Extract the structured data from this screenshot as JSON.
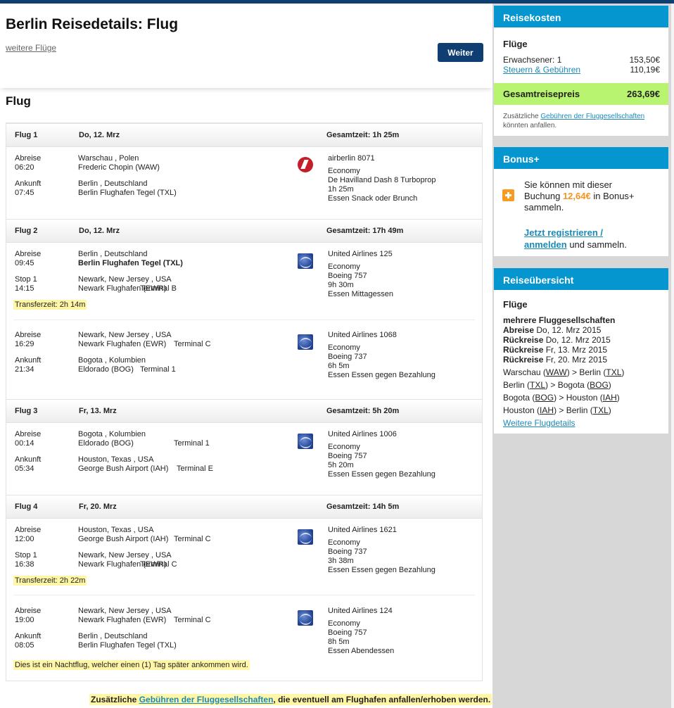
{
  "header": {
    "title": "Berlin Reisedetails: Flug",
    "more_flights": "weitere Flüge",
    "continue_label": "Weiter"
  },
  "section_title": "Flug",
  "labels": {
    "departure": "Abreise",
    "arrival": "Ankunft",
    "stop": "Stop 1"
  },
  "flights": [
    {
      "title": "Flug 1",
      "date": "Do, 12. Mrz",
      "total_time": "Gesamtzeit: 1h 25m",
      "segments": [
        {
          "dep_time": "06:20",
          "dep_place": "Warschau , Polen",
          "dep_airport": "Frederic Chopin (WAW)",
          "dep_terminal": "",
          "arr_time": "07:45",
          "arr_place": "Berlin , Deutschland",
          "arr_airport": "Berlin Flughafen Tegel (TXL)",
          "arr_terminal": "",
          "airline_logo": "airberlin-logo",
          "flight_no": "airberlin 8071",
          "cabin": "Economy",
          "aircraft": "De Havilland Dash 8 Turboprop",
          "duration": "1h 25m",
          "meal": "Essen Snack oder Brunch"
        }
      ]
    },
    {
      "title": "Flug 2",
      "date": "Do, 12. Mrz",
      "total_time": "Gesamtzeit: 17h 49m",
      "segments": [
        {
          "dep_time": "09:45",
          "dep_place": "Berlin , Deutschland",
          "dep_airport": "Berlin Flughafen Tegel (TXL)",
          "dep_terminal": "",
          "arr_time": "14:15",
          "arr_place": "Newark, New Jersey , USA",
          "arr_airport": "Newark Flughafen (EWR)",
          "arr_terminal": "Terminal B",
          "airline_logo": "united-airlines-logo",
          "flight_no": "United Airlines 125",
          "cabin": "Economy",
          "aircraft": "Boeing 757",
          "duration": "9h 30m",
          "meal": "Essen Mittagessen",
          "transfer": "Transferzeit: 2h 14m"
        },
        {
          "dep_time": "16:29",
          "dep_place": "Newark, New Jersey , USA",
          "dep_airport": "Newark Flughafen (EWR)",
          "dep_terminal": "Terminal C",
          "arr_time": "21:34",
          "arr_place": "Bogota , Kolumbien",
          "arr_airport": "Eldorado (BOG)",
          "arr_terminal": "Terminal 1",
          "airline_logo": "united-airlines-logo",
          "flight_no": "United Airlines 1068",
          "cabin": "Economy",
          "aircraft": "Boeing 737",
          "duration": "6h 5m",
          "meal": "Essen Essen gegen Bezahlung"
        }
      ]
    },
    {
      "title": "Flug 3",
      "date": "Fr, 13. Mrz",
      "total_time": "Gesamtzeit: 5h 20m",
      "segments": [
        {
          "dep_time": "00:14",
          "dep_place": "Bogota , Kolumbien",
          "dep_airport": "Eldorado (BOG)",
          "dep_terminal": "Terminal 1",
          "arr_time": "05:34",
          "arr_place": "Houston, Texas , USA",
          "arr_airport": "George Bush Airport (IAH)",
          "arr_terminal": "Terminal E",
          "airline_logo": "united-airlines-logo",
          "flight_no": "United Airlines 1006",
          "cabin": "Economy",
          "aircraft": "Boeing 757",
          "duration": "5h 20m",
          "meal": "Essen Essen gegen Bezahlung"
        }
      ]
    },
    {
      "title": "Flug 4",
      "date": "Fr, 20. Mrz",
      "total_time": "Gesamtzeit: 14h 5m",
      "segments": [
        {
          "dep_time": "12:00",
          "dep_place": "Houston, Texas , USA",
          "dep_airport": "George Bush Airport (IAH)",
          "dep_terminal": "Terminal C",
          "arr_time": "16:38",
          "arr_place": "Newark, New Jersey , USA",
          "arr_airport": "Newark Flughafen (EWR)",
          "arr_terminal": "Terminal C",
          "airline_logo": "united-airlines-logo",
          "flight_no": "United Airlines 1621",
          "cabin": "Economy",
          "aircraft": "Boeing 737",
          "duration": "3h 38m",
          "meal": "Essen Essen gegen Bezahlung",
          "transfer": "Transferzeit: 2h 22m"
        },
        {
          "dep_time": "19:00",
          "dep_place": "Newark, New Jersey , USA",
          "dep_airport": "Newark Flughafen (EWR)",
          "dep_terminal": "Terminal C",
          "arr_time": "08:05",
          "arr_place": "Berlin , Deutschland",
          "arr_airport": "Berlin Flughafen Tegel (TXL)",
          "arr_terminal": "",
          "airline_logo": "united-airlines-logo",
          "flight_no": "United Airlines 124",
          "cabin": "Economy",
          "aircraft": "Boeing 757",
          "duration": "8h 5m",
          "meal": "Essen Abendessen"
        }
      ],
      "night_note": "Dies ist ein Nachtflug, welcher einen (1) Tag später ankommen wird."
    }
  ],
  "footer_note": {
    "prefix": "Zusätzliche",
    "link": "Gebühren der Fluggesellschaften",
    "suffix": ", die eventuell am Flughafen anfallen/erhoben werden."
  },
  "costs": {
    "title": "Reisekosten",
    "subtitle": "Flüge",
    "adult_label": "Erwachsener: 1",
    "adult_price": "153,50€",
    "tax_label": "Steuern & Gebühren",
    "tax_price": "110,19€",
    "total_label": "Gesamtreisepreis",
    "total_price": "263,69€",
    "note_prefix": "Zusätzliche",
    "note_link": "Gebühren der Fluggesellschaften",
    "note_suffix": "könnten anfallen."
  },
  "bonus": {
    "title": "Bonus+",
    "line1": "Sie können mit dieser",
    "line2_prefix": "Buchung",
    "amount": "12,64€",
    "line2_suffix": "in Bonus+",
    "line3": "sammeln.",
    "register_line1": "Jetzt registrieren /",
    "register_line2": "anmelden",
    "register_suffix": "und sammeln."
  },
  "overview": {
    "title": "Reiseübersicht",
    "subtitle": "Flüge",
    "airlines": "mehrere Fluggesellschaften",
    "legs": [
      {
        "label": "Abreise",
        "date": "Do, 12. Mrz 2015"
      },
      {
        "label": "Rückreise",
        "date": "Do, 12. Mrz 2015"
      },
      {
        "label": "Rückreise",
        "date": "Fr, 13. Mrz 2015"
      },
      {
        "label": "Rückreise",
        "date": "Fr, 20. Mrz 2015"
      }
    ],
    "routes": [
      {
        "from": "Warschau",
        "from_code": "WAW",
        "to": "Berlin",
        "to_code": "TXL"
      },
      {
        "from": "Berlin",
        "from_code": "TXL",
        "to": "Bogota",
        "to_code": "BOG"
      },
      {
        "from": "Bogota",
        "from_code": "BOG",
        "to": "Houston",
        "to_code": "IAH"
      },
      {
        "from": "Houston",
        "from_code": "IAH",
        "to": "Berlin",
        "to_code": "TXL"
      }
    ],
    "details_link": "Weitere Flugdetails"
  }
}
